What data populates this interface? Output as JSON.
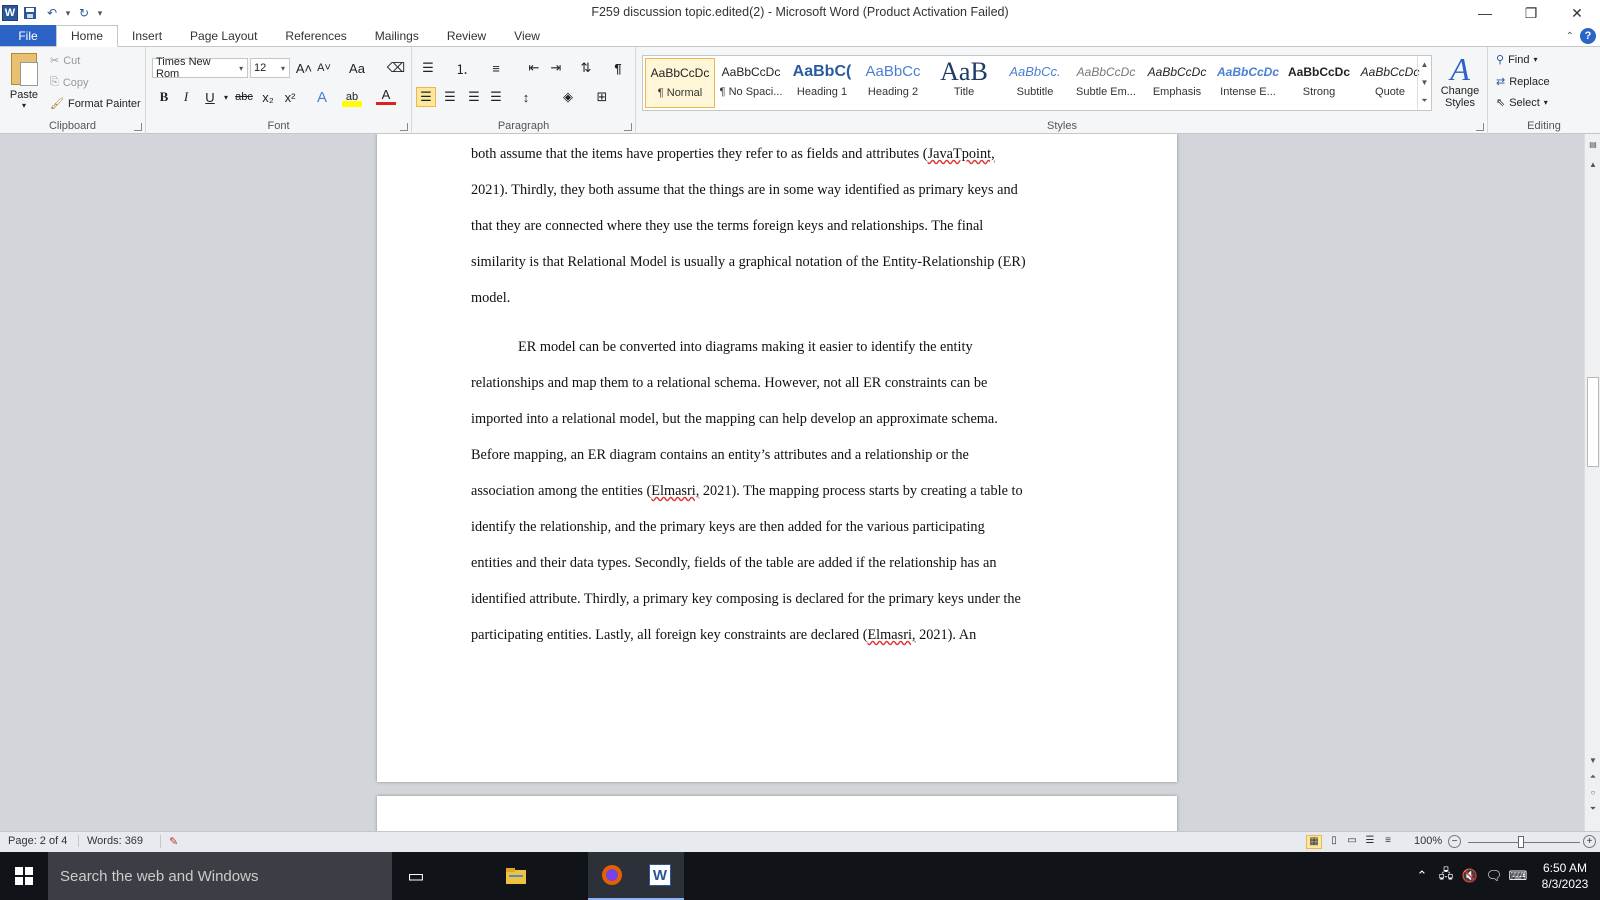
{
  "window": {
    "title": "F259 discussion topic.edited(2)  -  Microsoft Word (Product Activation Failed)",
    "app_logo": "W"
  },
  "tabs": [
    {
      "label": "File"
    },
    {
      "label": "Home"
    },
    {
      "label": "Insert"
    },
    {
      "label": "Page Layout"
    },
    {
      "label": "References"
    },
    {
      "label": "Mailings"
    },
    {
      "label": "Review"
    },
    {
      "label": "View"
    }
  ],
  "ribbon": {
    "clipboard": {
      "label": "Clipboard",
      "paste": "Paste",
      "cut": "Cut",
      "copy": "Copy",
      "format_painter": "Format Painter"
    },
    "font": {
      "label": "Font",
      "font_name": "Times New Rom",
      "font_size": "12",
      "bold": "B",
      "italic": "I",
      "underline": "U",
      "strikethrough": "abc",
      "subscript": "x₂",
      "superscript": "x²",
      "grow": "A˄",
      "shrink": "A˅",
      "change_case": "Aa",
      "font_color": "A",
      "text_effects": "A",
      "highlight": "ab"
    },
    "paragraph": {
      "label": "Paragraph",
      "pilcrow": "¶"
    },
    "styles": {
      "label": "Styles",
      "items": [
        {
          "sample": "AaBbCcDc",
          "name": "¶ Normal"
        },
        {
          "sample": "AaBbCcDc",
          "name": "¶ No Spaci..."
        },
        {
          "sample": "AaBbC(",
          "name": "Heading 1"
        },
        {
          "sample": "AaBbCc",
          "name": "Heading 2"
        },
        {
          "sample": "AaB",
          "name": "Title"
        },
        {
          "sample": "AaBbCc.",
          "name": "Subtitle"
        },
        {
          "sample": "AaBbCcDc",
          "name": "Subtle Em..."
        },
        {
          "sample": "AaBbCcDc",
          "name": "Emphasis"
        },
        {
          "sample": "AaBbCcDc",
          "name": "Intense E..."
        },
        {
          "sample": "AaBbCcDc",
          "name": "Strong"
        },
        {
          "sample": "AaBbCcDc",
          "name": "Quote"
        }
      ],
      "change_styles": "Change Styles"
    },
    "editing": {
      "label": "Editing",
      "find": "Find",
      "replace": "Replace",
      "select": "Select"
    }
  },
  "document": {
    "para1_lines": [
      "both assume that the items have properties they refer to as fields and attributes (",
      "2021). Thirdly, they both assume that the things are in some way identified as primary keys and",
      "that they are connected where they use the terms foreign keys and relationships. The final",
      "similarity is that Relational Model is usually a graphical notation of the Entity-Relationship (ER)",
      "model."
    ],
    "para1_cite": "JavaTpoint,",
    "para2_lines": [
      "ER model can be converted into diagrams making it easier to identify the entity",
      "relationships and map them to a relational schema. However, not all ER constraints can be",
      "imported into a relational model, but the mapping can help develop an approximate schema.",
      "Before mapping, an ER diagram contains an entity’s attributes and a relationship or the",
      "association among the entities (",
      "identify the relationship, and the primary keys are then added for the various participating",
      "entities and their data types. Secondly, fields of the table are added if the relationship has an",
      "identified attribute. Thirdly, a primary key composing is declared for the primary keys under the",
      "participating entities. Lastly, all foreign key constraints are declared ("
    ],
    "cite_elmasri": "Elmasri,",
    "line5_tail": " 2021). The mapping process starts by creating a table to",
    "line9_tail": " 2021). An"
  },
  "statusbar": {
    "page": "Page: 2 of 4",
    "words": "Words: 369",
    "zoom": "100%"
  },
  "taskbar": {
    "search_placeholder": "Search the web and Windows",
    "time": "6:50 AM",
    "date": "8/3/2023"
  },
  "colors": {
    "file_tab": "#2b64c6",
    "doc_background": "#d2d5d9",
    "taskbar": "#101318"
  }
}
